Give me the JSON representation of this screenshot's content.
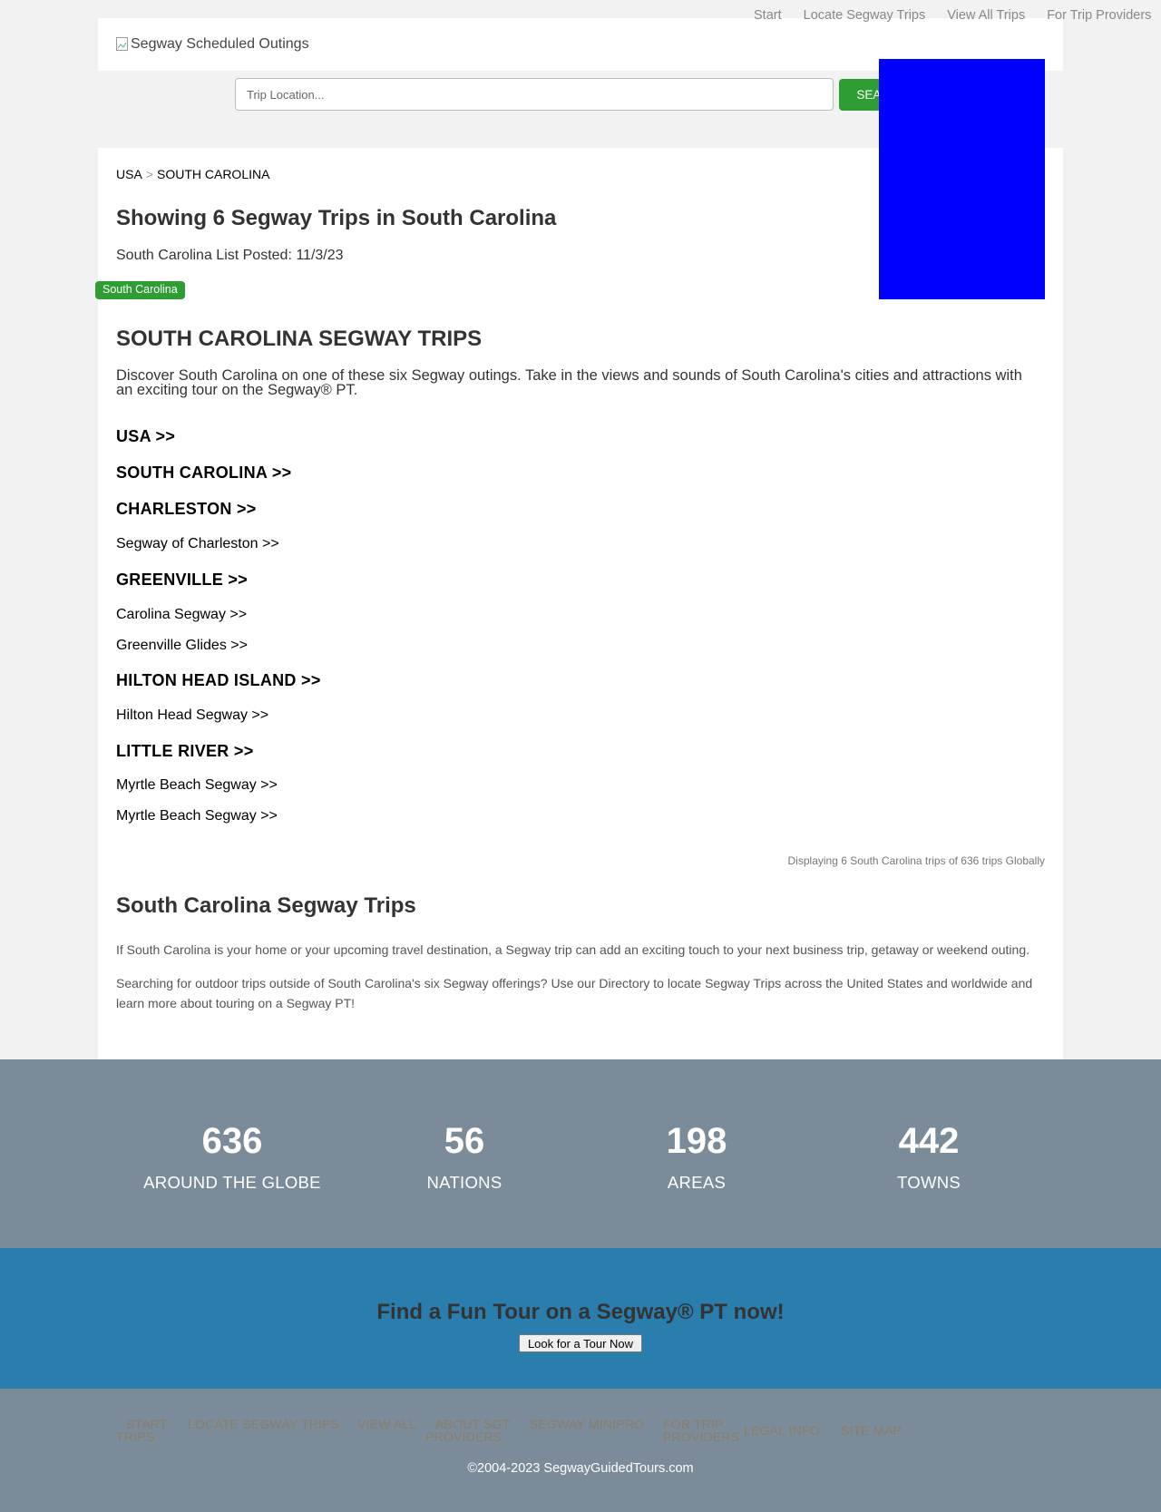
{
  "header": {
    "logo_alt": "Segway Scheduled Outings",
    "nav": [
      "Start",
      "Locate Segway Trips",
      "View All Trips",
      "For Trip Providers"
    ]
  },
  "search": {
    "placeholder": "Trip Location...",
    "button": "SEARCH"
  },
  "colors": {
    "accent_green": "#2e9e34",
    "ad_blue": "#0000ff",
    "stats_bg": "#7b8b99",
    "cta_bg": "#2a7eae"
  },
  "breadcrumb": {
    "items": [
      "USA",
      "SOUTH CAROLINA"
    ],
    "separator": ">"
  },
  "page": {
    "title": "Showing 6 Segway Trips in South Carolina",
    "posted": "South Carolina List Posted: 11/3/23",
    "badge": "South Carolina",
    "section_title": "SOUTH CAROLINA SEGWAY TRIPS",
    "intro": "Discover South Carolina on one of these six Segway outings. Take in the views and sounds of South Carolina's cities and attractions with an exciting tour on the Segway® PT."
  },
  "directory": {
    "usa": "USA >>",
    "state": "SOUTH CAROLINA >>",
    "cities": [
      {
        "name": "CHARLESTON >>",
        "trips": [
          "Segway of Charleston >>"
        ]
      },
      {
        "name": "GREENVILLE >>",
        "trips": [
          "Carolina Segway >>",
          "Greenville Glides >>"
        ]
      },
      {
        "name": "HILTON HEAD ISLAND >>",
        "trips": [
          "Hilton Head Segway >>"
        ]
      },
      {
        "name": "LITTLE RIVER >>",
        "trips": [
          "Myrtle Beach Segway >>",
          "Myrtle Beach Segway >>"
        ]
      }
    ]
  },
  "count_text": "Displaying 6 South Carolina trips of 636 trips Globally",
  "about": {
    "title": "South Carolina Segway Trips",
    "p1": "If South Carolina is your home or your upcoming travel destination, a Segway trip can add an exciting touch to your next business trip, getaway or weekend outing.",
    "p2": "Searching for outdoor trips outside of South Carolina's six Segway offerings? Use our Directory to locate Segway Trips across the United States and worldwide and learn more about touring on a Segway PT!"
  },
  "stats": [
    {
      "value": "636",
      "label": "AROUND THE GLOBE"
    },
    {
      "value": "56",
      "label": "NATIONS"
    },
    {
      "value": "198",
      "label": "AREAS"
    },
    {
      "value": "442",
      "label": "TOWNS"
    }
  ],
  "cta": {
    "title": "Find a Fun Tour on a Segway® PT now!",
    "button": "Look for a Tour Now"
  },
  "footer": {
    "nav": [
      "START TRIPS",
      "LOCATE SEGWAY TRIPS",
      "VIEW ALL",
      "ABOUT SGT PROVIDERS",
      "SEGWAY MINIPRO",
      "FOR TRIP PROVIDERS",
      "LEGAL INFO",
      "SITE MAP"
    ],
    "copyright": "©2004-2023 SegwayGuidedTours.com"
  }
}
